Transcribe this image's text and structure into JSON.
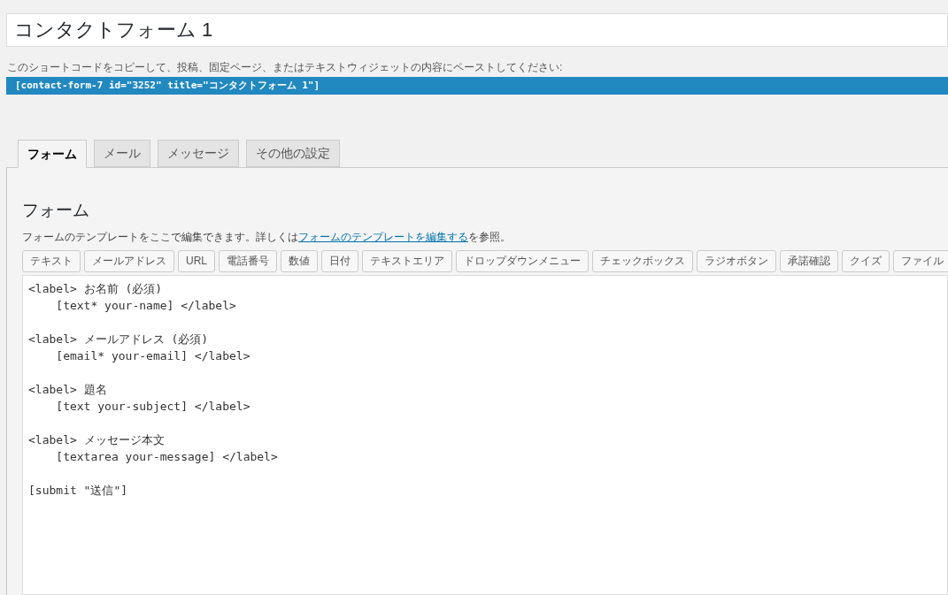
{
  "title_field": {
    "value": "コンタクトフォーム 1"
  },
  "shortcode_hint": "このショートコードをコピーして、投稿、固定ページ、またはテキストウィジェットの内容にペーストしてください:",
  "shortcode": "[contact-form-7 id=\"3252\" title=\"コンタクトフォーム 1\"]",
  "tabs": [
    {
      "label": "フォーム",
      "selected": true
    },
    {
      "label": "メール",
      "selected": false
    },
    {
      "label": "メッセージ",
      "selected": false
    },
    {
      "label": "その他の設定",
      "selected": false
    }
  ],
  "panel": {
    "heading": "フォーム",
    "description": {
      "before": "フォームのテンプレートをここで編集できます。詳しくは",
      "link": "フォームのテンプレートを編集する",
      "after": "を参照。"
    },
    "tag_buttons": [
      "テキスト",
      "メールアドレス",
      "URL",
      "電話番号",
      "数値",
      "日付",
      "テキストエリア",
      "ドロップダウンメニュー",
      "チェックボックス",
      "ラジオボタン",
      "承諾確認",
      "クイズ",
      "ファイル"
    ],
    "editor_blocks": [
      [
        "<label> お名前 (必須)",
        "    [text* your-name] </label>"
      ],
      [
        "<label> メールアドレス (必須)",
        "    [email* your-email] </label>"
      ],
      [
        "<label> 題名",
        "    [text your-subject] </label>"
      ],
      [
        "<label> メッセージ本文",
        "    [textarea your-message] </label>"
      ],
      [
        "[submit \"送信\"]"
      ]
    ]
  }
}
